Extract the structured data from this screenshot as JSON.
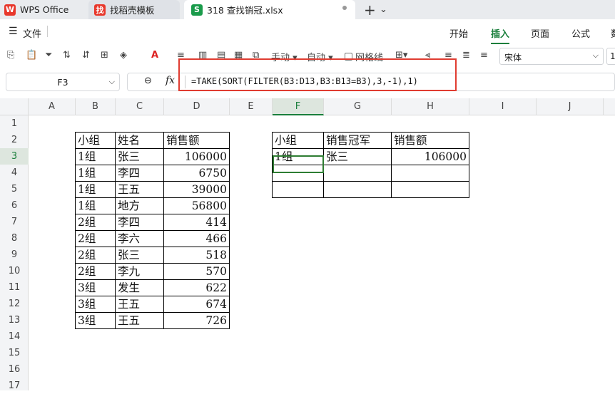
{
  "tabs": [
    {
      "label": "WPS Office",
      "logo": "W",
      "logo_color": "#e8382c"
    },
    {
      "label": "找稻壳模板",
      "logo": "找",
      "logo_color": "#e8382c"
    },
    {
      "label": "318 查找销冠.xlsx",
      "logo": "S",
      "logo_color": "#1a9b4b"
    }
  ],
  "tab_bar": {
    "new_tab_icon": "+",
    "dropdown_icon": "⌄"
  },
  "menu": {
    "file_label": "文件",
    "tabs": [
      "开始",
      "插入",
      "页面",
      "公式",
      "数"
    ],
    "active_tab": "插入"
  },
  "toolbar": {
    "manual_label": "手动",
    "auto_label": "自动",
    "gridlines_label": "网格线",
    "font_name": "宋体",
    "font_size": "1"
  },
  "formula_bar": {
    "cell_ref": "F3",
    "fx_label": "fx",
    "formula": "=TAKE(SORT(FILTER(B3:D13,B3:B13=B3),3,-1),1)"
  },
  "columns": [
    "A",
    "B",
    "C",
    "D",
    "E",
    "F",
    "G",
    "H",
    "I",
    "J"
  ],
  "rows": [
    "1",
    "2",
    "3",
    "4",
    "5",
    "6",
    "7",
    "8",
    "9",
    "10",
    "11",
    "12",
    "13",
    "14",
    "15",
    "16",
    "17"
  ],
  "selected_cell": {
    "column": "F",
    "row": "3"
  },
  "source_table": {
    "headers": [
      "小组",
      "姓名",
      "销售额"
    ],
    "rows": [
      [
        "1组",
        "张三",
        "106000"
      ],
      [
        "1组",
        "李四",
        "6750"
      ],
      [
        "1组",
        "王五",
        "39000"
      ],
      [
        "1组",
        "地方",
        "56800"
      ],
      [
        "2组",
        "李四",
        "414"
      ],
      [
        "2组",
        "李六",
        "466"
      ],
      [
        "2组",
        "张三",
        "518"
      ],
      [
        "2组",
        "李九",
        "570"
      ],
      [
        "3组",
        "发生",
        "622"
      ],
      [
        "3组",
        "王五",
        "674"
      ],
      [
        "3组",
        "王五",
        "726"
      ]
    ]
  },
  "result_table": {
    "headers": [
      "小组",
      "销售冠军",
      "销售额"
    ],
    "rows": [
      [
        "1组",
        "张三",
        "106000"
      ],
      [
        "",
        "",
        ""
      ],
      [
        "",
        "",
        ""
      ]
    ]
  }
}
